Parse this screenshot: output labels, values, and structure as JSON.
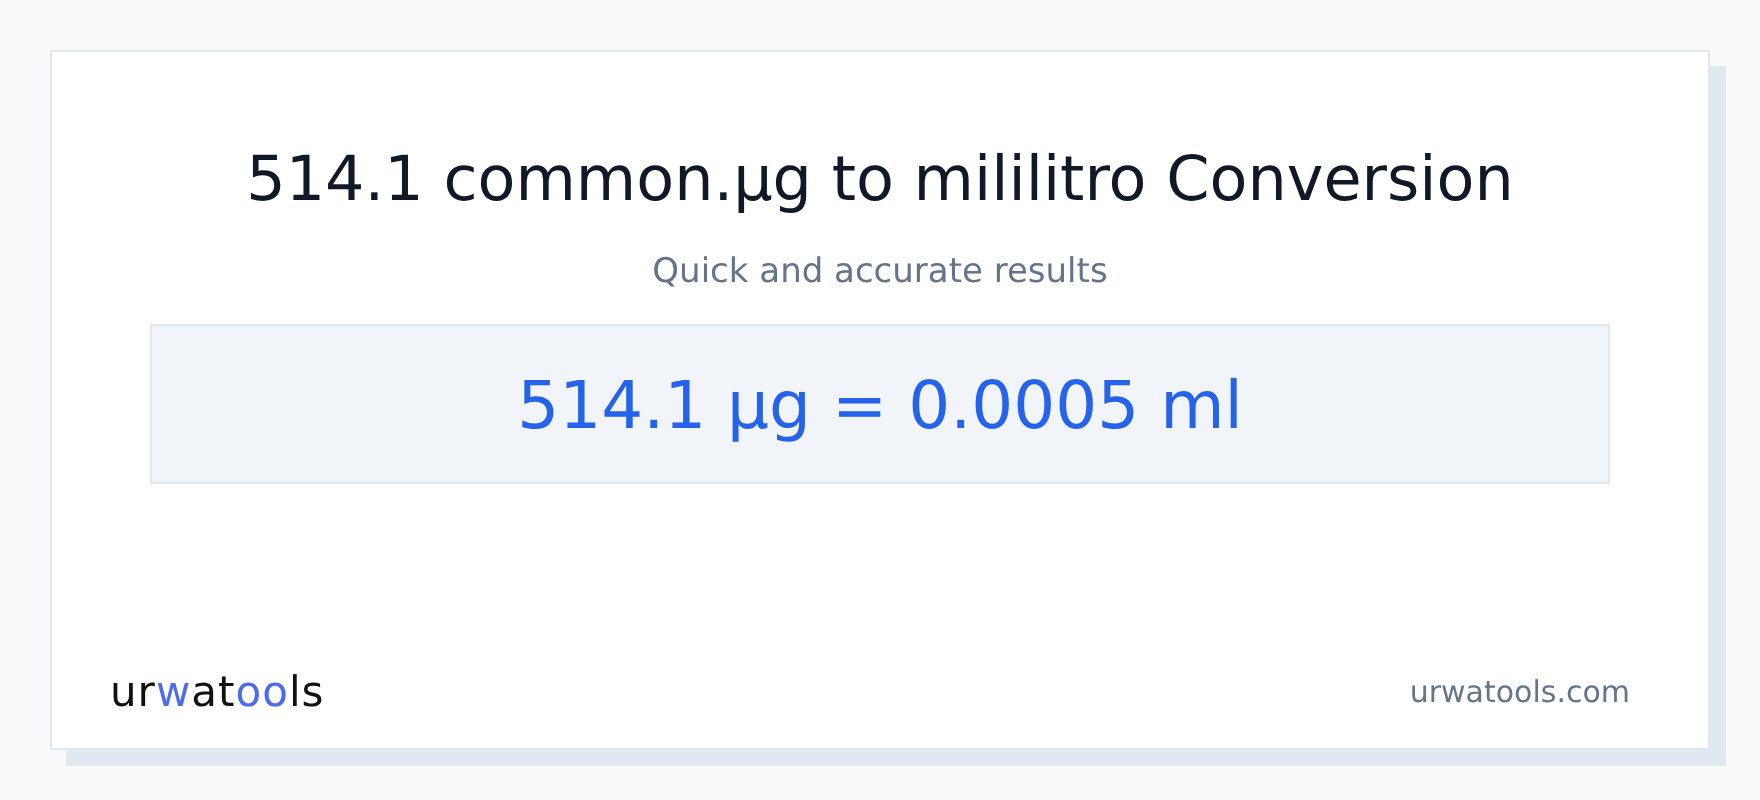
{
  "title": "514.1 common.µg to mililitro Conversion",
  "subtitle": "Quick and accurate results",
  "result": "514.1 µg = 0.0005 ml",
  "logo": [
    {
      "text": "ur",
      "accent": false
    },
    {
      "text": "w",
      "accent": true
    },
    {
      "text": "at",
      "accent": false
    },
    {
      "text": "oo",
      "accent": true
    },
    {
      "text": "ls",
      "accent": false
    }
  ],
  "site": "urwatools.com"
}
